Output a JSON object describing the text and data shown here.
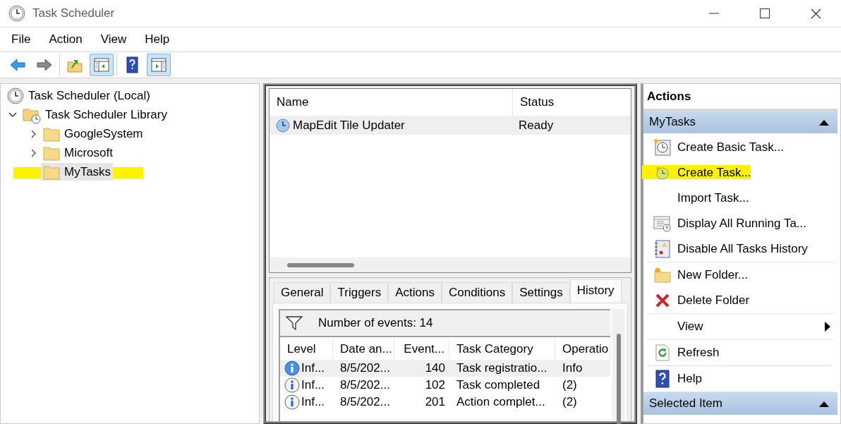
{
  "window": {
    "title": "Task Scheduler"
  },
  "menu": [
    "File",
    "Action",
    "View",
    "Help"
  ],
  "toolbar": [
    [
      {
        "kind": "back",
        "pressed": false
      },
      {
        "kind": "forward",
        "pressed": false
      }
    ],
    [
      {
        "kind": "up-folder",
        "pressed": false
      },
      {
        "kind": "console-tree",
        "pressed": true
      }
    ],
    [
      {
        "kind": "help",
        "pressed": false
      },
      {
        "kind": "action-pane",
        "pressed": true
      }
    ]
  ],
  "tree": [
    {
      "label": "Task Scheduler (Local)",
      "kind": "clock",
      "selected": false,
      "highlighted": false,
      "children": [
        {
          "label": "Task Scheduler Library",
          "kind": "library",
          "expanded": true,
          "selected": false,
          "highlighted": false,
          "children": [
            {
              "label": "GoogleSystem",
              "kind": "folder",
              "expanded": false,
              "selected": false,
              "highlighted": false
            },
            {
              "label": "Microsoft",
              "kind": "folder",
              "expanded": false,
              "selected": false,
              "highlighted": false
            },
            {
              "label": "MyTasks",
              "kind": "folder",
              "selected": true,
              "highlighted": true
            }
          ]
        }
      ]
    }
  ],
  "task_list": {
    "columns": [
      "Name",
      "Status"
    ],
    "rows": [
      {
        "name": "MapEdit Tile Updater",
        "status": "Ready",
        "selected": true
      }
    ]
  },
  "details": {
    "tabs": [
      {
        "label": "General",
        "selected": false
      },
      {
        "label": "Triggers",
        "selected": false
      },
      {
        "label": "Actions",
        "selected": false
      },
      {
        "label": "Conditions",
        "selected": false
      },
      {
        "label": "Settings",
        "selected": false
      },
      {
        "label": "History",
        "selected": true
      }
    ],
    "history": {
      "event_count": "Number of events: 14",
      "columns": [
        "Level",
        "Date an...",
        "Event...",
        "Task Category",
        "Operatio"
      ],
      "rows": [
        {
          "level": "Inf...",
          "date": "8/5/202...",
          "event_id": "140",
          "category": "Task registratio...",
          "opcode": "Info",
          "selected": true
        },
        {
          "level": "Inf...",
          "date": "8/5/202...",
          "event_id": "102",
          "category": "Task completed",
          "opcode": "(2)",
          "selected": false
        },
        {
          "level": "Inf...",
          "date": "8/5/202...",
          "event_id": "201",
          "category": "Action complet...",
          "opcode": "(2)",
          "selected": false
        }
      ]
    }
  },
  "actions": {
    "title": "Actions",
    "sections": [
      {
        "title": "MyTasks",
        "expanded": true,
        "groups": [
          [
            {
              "label": "Create Basic Task...",
              "kind": "basic-task",
              "submenu": false,
              "highlighted": false
            },
            {
              "label": "Create Task...",
              "kind": "create-task",
              "submenu": false,
              "highlighted": true
            },
            {
              "label": "Import Task...",
              "kind": "plain",
              "submenu": false,
              "highlighted": false
            },
            {
              "label": "Display All Running Ta...",
              "kind": "running",
              "submenu": false,
              "highlighted": false
            },
            {
              "label": "Disable All Tasks History",
              "kind": "history",
              "submenu": false,
              "highlighted": false
            }
          ],
          [
            {
              "label": "New Folder...",
              "kind": "new-folder",
              "submenu": false,
              "highlighted": false
            },
            {
              "label": "Delete Folder",
              "kind": "delete",
              "submenu": false,
              "highlighted": false
            }
          ],
          [
            {
              "label": "View",
              "kind": "plain",
              "submenu": true,
              "highlighted": false
            }
          ],
          [
            {
              "label": "Refresh",
              "kind": "refresh",
              "submenu": false,
              "highlighted": false
            }
          ],
          [
            {
              "label": "Help",
              "kind": "help",
              "submenu": false,
              "highlighted": false
            }
          ]
        ]
      },
      {
        "title": "Selected Item",
        "expanded": true
      }
    ]
  }
}
